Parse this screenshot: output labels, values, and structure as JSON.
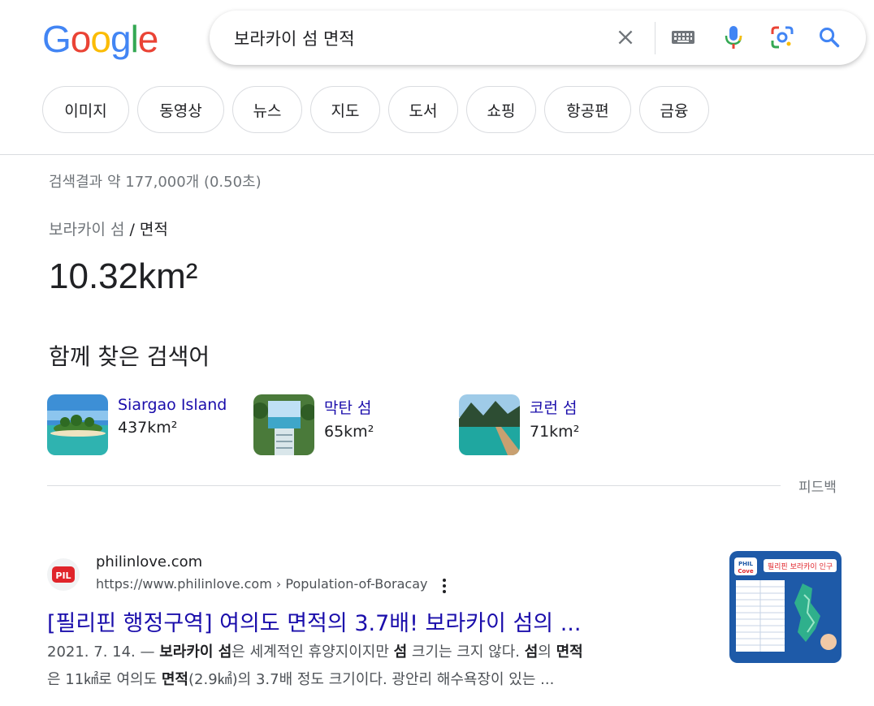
{
  "logo": {
    "letters": [
      "G",
      "o",
      "o",
      "g",
      "l",
      "e"
    ]
  },
  "search": {
    "query": "보라카이 섬 면적"
  },
  "icons": [
    "close-icon",
    "keyboard-icon",
    "mic-icon",
    "lens-icon",
    "search-icon"
  ],
  "tabs": [
    "이미지",
    "동영상",
    "뉴스",
    "지도",
    "도서",
    "쇼핑",
    "항공편",
    "금융"
  ],
  "stats": "검색결과 약 177,000개 (0.50초)",
  "breadcrumb": {
    "parent": "보라카이 섬",
    "sep": "/",
    "current": "면적"
  },
  "answer": "10.32km²",
  "related": {
    "heading": "함께 찾은 검색어",
    "items": [
      {
        "name": "Siargao Island",
        "value": "437km²"
      },
      {
        "name": "막탄 섬",
        "value": "65km²"
      },
      {
        "name": "코런 섬",
        "value": "71km²"
      }
    ]
  },
  "feedback": "피드백",
  "result": {
    "site": "philinlove.com",
    "url": "https://www.philinlove.com › Population-of-Boracay",
    "title": "[필리핀 행정구역] 여의도 면적의 3.7배! 보라카이 섬의 ...",
    "favicon_text": "PIL",
    "thumb_header": "필리핀 보라카이 인구",
    "thumb_logo_1": "PHIL",
    "thumb_logo_2": "Cove",
    "snippet": {
      "date": "2021. 7. 14. — ",
      "b1": "보라카이 섬",
      "t1": "은 세계적인 휴양지이지만 ",
      "b2": "섬",
      "t2": " 크기는 크지 않다. ",
      "b3": "섬",
      "t3": "의 ",
      "b4": "면적",
      "t4": "은 11㎢로 여의도 ",
      "b5": "면적",
      "t5": "(2.9㎢)의 3.7배 정도 크기이다. 광안리 해수욕장이 있는 ..."
    }
  },
  "colors": {
    "blue": "#4285F4",
    "red": "#EA4335",
    "yellow": "#FBBC05",
    "green": "#34A853",
    "link": "#1a0dab"
  }
}
